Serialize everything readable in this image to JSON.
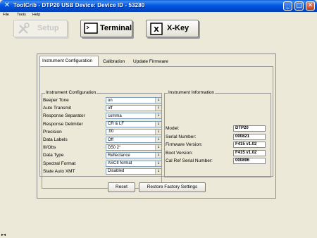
{
  "window": {
    "title": "ToolCrib - DTP20 USB Device: Device ID - 53280",
    "minimize": "_",
    "maximize": "□",
    "close": "✕"
  },
  "menu": [
    "File",
    "Tools",
    "Help"
  ],
  "toolbar": {
    "setup": "Setup",
    "terminal": "Terminal",
    "xkey": "X-Key",
    "xkey_icon_letter": "X"
  },
  "tabs": [
    "Instrument Configuration",
    "Calibration",
    "Update Firmware"
  ],
  "config": {
    "heading": "Instrument Configuration",
    "rows": [
      {
        "label": "Beeper Tone",
        "value": "on"
      },
      {
        "label": "Auto Transmit",
        "value": "off"
      },
      {
        "label": "Response Separator",
        "value": "comma"
      },
      {
        "label": "Response Delimiter",
        "value": "CR & LF"
      },
      {
        "label": "Precision",
        "value": ".00"
      },
      {
        "label": "Data Labels",
        "value": "Off"
      },
      {
        "label": "Ill/Obs",
        "value": "D50 2°"
      },
      {
        "label": "Data Type",
        "value": "Reflectance"
      },
      {
        "label": "Spectral Format",
        "value": "ASCII format"
      },
      {
        "label": "State Auto XMT",
        "value": "Disabled"
      }
    ]
  },
  "info": {
    "heading": "Instrument Information",
    "rows": [
      {
        "label": "Model:",
        "value": "DTP20"
      },
      {
        "label": "Serial Number:",
        "value": "000821"
      },
      {
        "label": "Firmware Version:",
        "value": "F415 v1.02"
      },
      {
        "label": "Boot Version:",
        "value": "F415 v1.02"
      },
      {
        "label": "Cal Ref Serial Number:",
        "value": "000896"
      }
    ]
  },
  "buttons": {
    "reset": "Reset",
    "restore": "Restore Factory Settings"
  },
  "icons": {
    "select_arrow": "↓",
    "corner": "▸◂"
  }
}
